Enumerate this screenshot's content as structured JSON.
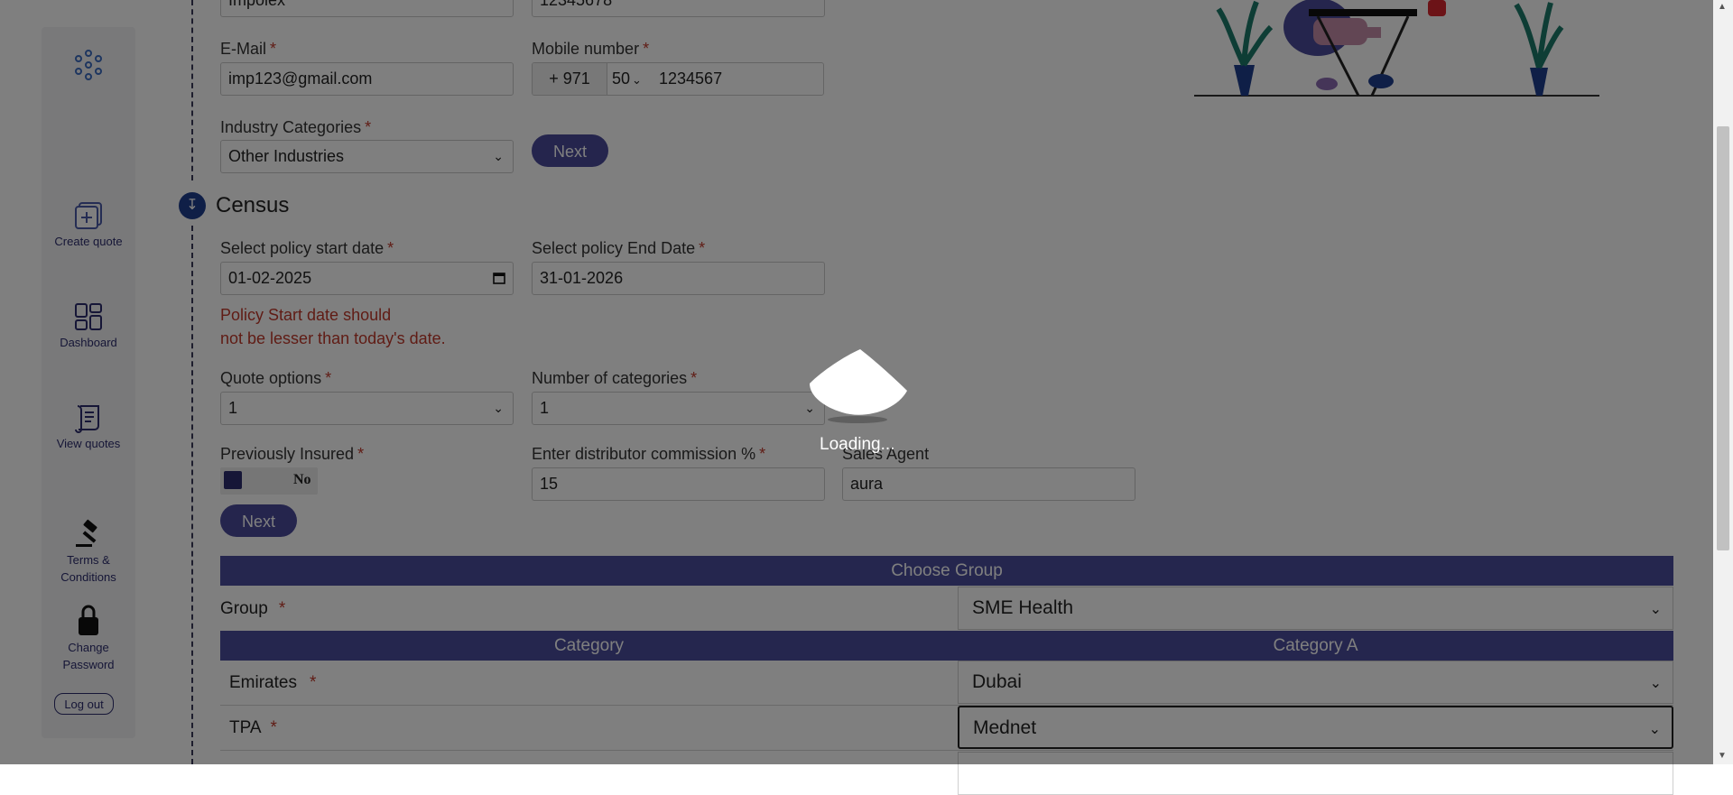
{
  "sidebar": {
    "create_quote": "Create quote",
    "dashboard": "Dashboard",
    "view_quotes": "View quotes",
    "terms_line1": "Terms &",
    "terms_line2": "Conditions",
    "change_line1": "Change",
    "change_line2": "Password",
    "logout": "Log out"
  },
  "company_form": {
    "company_value": "Impolex",
    "phone_value": "12345678",
    "email_label": "E-Mail",
    "email_value": "imp123@gmail.com",
    "mobile_label": "Mobile number",
    "country_code": "+ 971",
    "mobile_prefix": "50",
    "mobile_value": "1234567",
    "industry_label": "Industry Categories",
    "industry_value": "Other Industries",
    "next_label": "Next"
  },
  "census": {
    "title": "Census",
    "step_icon": "↧",
    "start_label": "Select policy start date",
    "start_value": "01-02-2025",
    "end_label": "Select policy End Date",
    "end_value": "31-01-2026",
    "error_line1": "Policy Start date should",
    "error_line2": "not be lesser than today's date.",
    "quote_options_label": "Quote options",
    "quote_options_value": "1",
    "num_categories_label": "Number of categories",
    "num_categories_value": "1",
    "prev_insured_label": "Previously Insured",
    "prev_insured_value": "No",
    "commission_label": "Enter distributor commission %",
    "commission_value": "15",
    "sales_agent_label": "Sales Agent",
    "sales_agent_value": "aura",
    "next_label": "Next",
    "required_mark": "*"
  },
  "group_table": {
    "choose_group": "Choose Group",
    "group_label": "Group",
    "group_value": "SME Health",
    "category_header": "Category",
    "category_a_header": "Category A",
    "emirates_label": "Emirates",
    "emirates_value": "Dubai",
    "tpa_label": "TPA",
    "tpa_value": "Mednet"
  },
  "overlay": {
    "loading_text": "Loading..."
  },
  "colors": {
    "accent": "#4a4d9c",
    "error": "#c0392b",
    "step": "#1f3f8f"
  }
}
